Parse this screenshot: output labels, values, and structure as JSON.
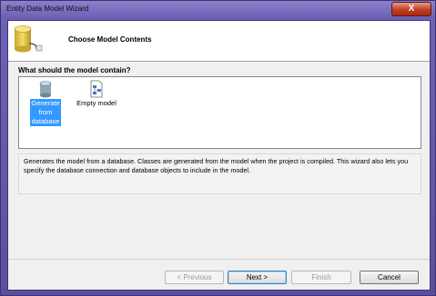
{
  "window": {
    "title": "Entity Data Model Wizard",
    "close_glyph": "X"
  },
  "header": {
    "title": "Choose Model Contents",
    "icon": "database-icon"
  },
  "main": {
    "question": "What should the model contain?",
    "options": [
      {
        "label_lines": [
          "Generate",
          "from",
          "database"
        ],
        "icon": "database-icon",
        "selected": true
      },
      {
        "label_lines": [
          "Empty model"
        ],
        "icon": "empty-model-icon",
        "selected": false
      }
    ],
    "description": "Generates the model from a database. Classes are generated from the model when the project is compiled. This wizard also lets you specify the database connection and database objects to include in the model."
  },
  "buttons": {
    "previous": "< Previous",
    "next": "Next >",
    "finish": "Finish",
    "cancel": "Cancel"
  },
  "colors": {
    "selection": "#3399ff",
    "frame": "#6f63b6"
  }
}
